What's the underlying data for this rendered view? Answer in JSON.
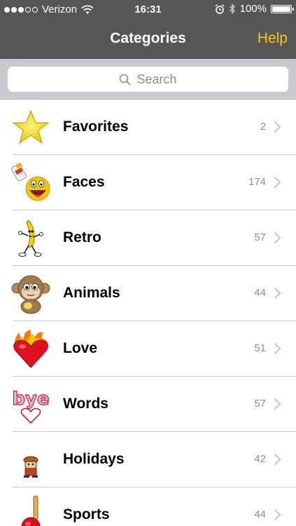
{
  "status_bar": {
    "carrier": "Verizon",
    "time": "16:31",
    "battery": "100%",
    "battery_level": 1.0,
    "signal_bars_filled": 3,
    "signal_bars_total": 5
  },
  "nav": {
    "title": "Categories",
    "help_label": "Help",
    "help_color": "#f5c518"
  },
  "search": {
    "placeholder": "Search"
  },
  "categories": [
    {
      "label": "Favorites",
      "count": "2",
      "icon": "star-icon"
    },
    {
      "label": "Faces",
      "count": "174",
      "icon": "laughing-face-icon"
    },
    {
      "label": "Retro",
      "count": "57",
      "icon": "dancing-banana-icon"
    },
    {
      "label": "Animals",
      "count": "44",
      "icon": "monkey-icon"
    },
    {
      "label": "Love",
      "count": "51",
      "icon": "flaming-heart-icon"
    },
    {
      "label": "Words",
      "count": "57",
      "icon": "bye-word-icon"
    },
    {
      "label": "Holidays",
      "count": "42",
      "icon": "holiday-figure-icon"
    },
    {
      "label": "Sports",
      "count": "44",
      "icon": "baseball-bat-icon"
    }
  ],
  "colors": {
    "bar_background": "#565656",
    "search_background": "#c9c9ce",
    "accent": "#f5c518"
  }
}
